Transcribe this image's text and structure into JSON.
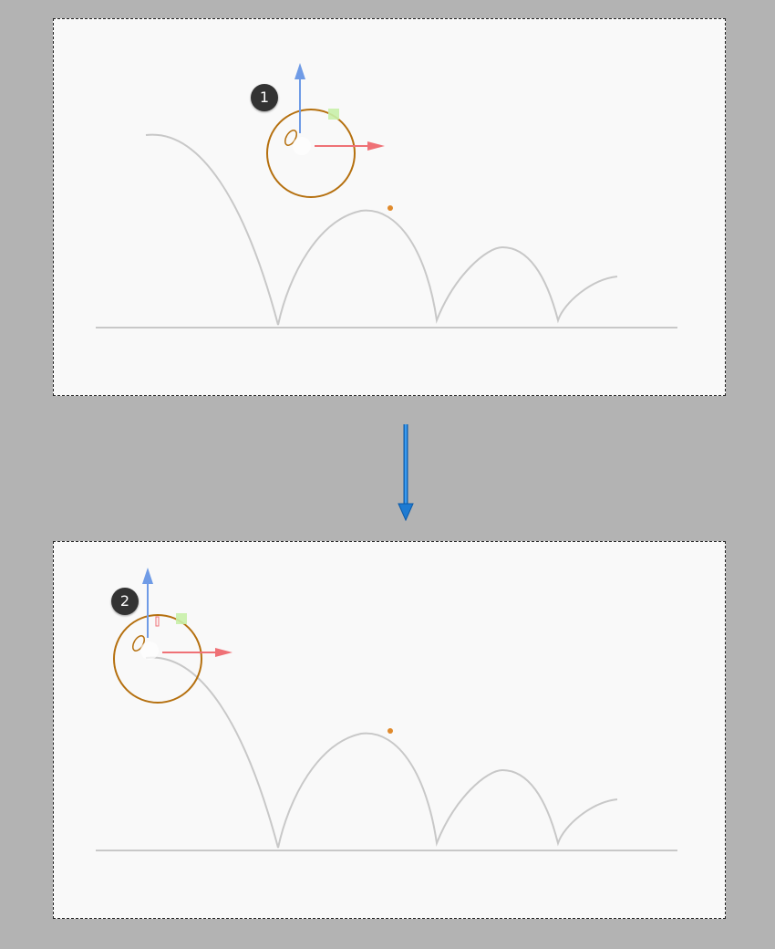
{
  "steps": [
    {
      "number": "1"
    },
    {
      "number": "2"
    }
  ],
  "icons": {
    "step_arrow": "arrow-down-icon",
    "y_axis_handle": "arrow-up-icon",
    "x_axis_handle": "arrow-right-icon",
    "plane_handle": "square-handle-icon"
  },
  "colors": {
    "background": "#b3b3b3",
    "canvas": "#f9f9f9",
    "motion_path": "#c8c8c8",
    "ball_outline": "#b5700f",
    "y_axis": "#6f9be6",
    "x_axis": "#ef7176",
    "plane_handle": "#c8f0a8",
    "keyframe_dot": "#e08a2c",
    "badge": "#333333",
    "step_arrow": "#1e7bd2"
  }
}
